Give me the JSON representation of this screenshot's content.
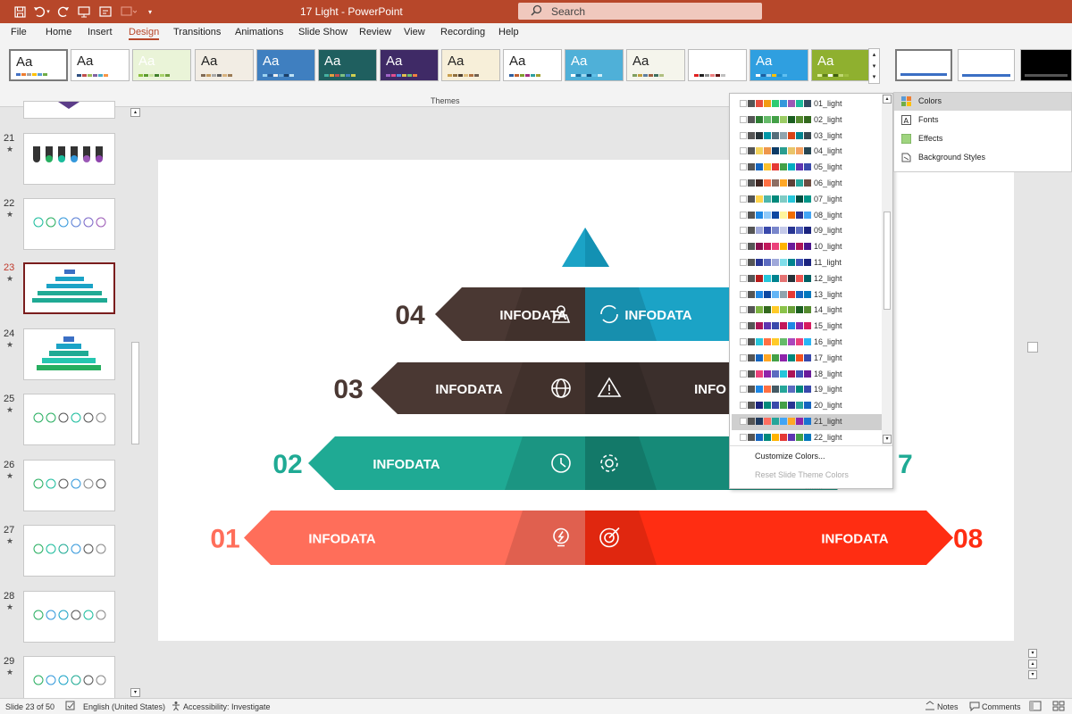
{
  "titlebar": {
    "doc_title": "17 Light  -  PowerPoint",
    "search_label": "Search"
  },
  "menu": [
    "File",
    "Home",
    "Insert",
    "Design",
    "Transitions",
    "Animations",
    "Slide Show",
    "Review",
    "View",
    "Recording",
    "Help"
  ],
  "themes": {
    "label": "Themes",
    "items": [
      {
        "bg": "#ffffff",
        "fg": "#222222",
        "pal": [
          "#4472c4",
          "#ed7d31",
          "#a5a5a5",
          "#ffc000",
          "#5b9bd5",
          "#70ad47"
        ]
      },
      {
        "bg": "#ffffff",
        "fg": "#222222",
        "pal": [
          "#2f4f7f",
          "#c0504d",
          "#9bbb59",
          "#8064a2",
          "#4bacc6",
          "#f79646"
        ]
      },
      {
        "bg": "#eaf4d8",
        "fg": "#ffffff",
        "pal": [
          "#8cbf3f",
          "#5b9b2e",
          "#c9e39c",
          "#3f7f2a",
          "#a8d26b",
          "#6e9e3c"
        ]
      },
      {
        "bg": "#f2ede4",
        "fg": "#222222",
        "pal": [
          "#7f6a55",
          "#c09860",
          "#a9a9a9",
          "#5e5e5e",
          "#d8b27f",
          "#9b7b55"
        ]
      },
      {
        "bg": "#3f7fc0",
        "fg": "#ffffff",
        "pal": [
          "#9ed3f0",
          "#2e5f99",
          "#f0f0f0",
          "#6aa7d8",
          "#1d3f66",
          "#bfe2f5"
        ]
      },
      {
        "bg": "#1f5f5f",
        "fg": "#ffffff",
        "pal": [
          "#45b0a0",
          "#e0a040",
          "#c04f4f",
          "#80c080",
          "#4080c0",
          "#d0d050"
        ]
      },
      {
        "bg": "#3f2a66",
        "fg": "#ffffff",
        "pal": [
          "#a064c8",
          "#e04f8f",
          "#4f8fe0",
          "#e0c04f",
          "#6fc06f",
          "#f08040"
        ]
      },
      {
        "bg": "#f7efd9",
        "fg": "#222222",
        "pal": [
          "#c89f4f",
          "#8f6f3f",
          "#4f3f2f",
          "#e0c080",
          "#b07040",
          "#706050"
        ]
      },
      {
        "bg": "#ffffff",
        "fg": "#222222",
        "pal": [
          "#2f5f9f",
          "#c05f2f",
          "#7f9f2f",
          "#9f2f7f",
          "#2f9f9f",
          "#9f9f2f"
        ]
      },
      {
        "bg": "#4fb0d8",
        "fg": "#ffffff",
        "pal": [
          "#ffffff",
          "#1f6f9f",
          "#9fd8f0",
          "#0f4f7f",
          "#60c0e8",
          "#d0eef8"
        ]
      },
      {
        "bg": "#f5f5ec",
        "fg": "#222222",
        "pal": [
          "#7f9f5f",
          "#c09f3f",
          "#5f7f9f",
          "#9f5f3f",
          "#3f6f5f",
          "#b0c080"
        ]
      },
      {
        "bg": "#ffffff",
        "fg": "#ffffff",
        "pal": [
          "#e02020",
          "#202020",
          "#909090",
          "#f08080",
          "#601010",
          "#c0c0c0"
        ]
      },
      {
        "bg": "#2f9fe0",
        "fg": "#ffffff",
        "pal": [
          "#ffffff",
          "#1f5f9f",
          "#9fd0f0",
          "#ffc000",
          "#1f8fcf",
          "#5fbff0"
        ]
      },
      {
        "bg": "#8fb02f",
        "fg": "#ffffff",
        "pal": [
          "#e0f0a0",
          "#5f7f1f",
          "#ffffff",
          "#3f5f10",
          "#c0d870",
          "#a0c040"
        ]
      }
    ]
  },
  "variants": [
    {
      "bg": "#ffffff"
    },
    {
      "bg": "#ffffff"
    },
    {
      "bg": "#000000"
    }
  ],
  "slides": [
    {
      "num": "21",
      "star": "★"
    },
    {
      "num": "22",
      "star": "★"
    },
    {
      "num": "23",
      "star": "★"
    },
    {
      "num": "24",
      "star": "★"
    },
    {
      "num": "25",
      "star": "★"
    },
    {
      "num": "26",
      "star": "★"
    },
    {
      "num": "27",
      "star": "★"
    },
    {
      "num": "28",
      "star": "★"
    },
    {
      "num": "29",
      "star": "★"
    }
  ],
  "colors_dropdown": {
    "items": [
      {
        "name": "01_light",
        "sw": [
          "#ffffff",
          "#555555",
          "#e84c3d",
          "#f39c12",
          "#2ecc71",
          "#3498db",
          "#9b59b6",
          "#1abc9c",
          "#34495e"
        ]
      },
      {
        "name": "02_light",
        "sw": [
          "#ffffff",
          "#555555",
          "#2e7d32",
          "#66bb6a",
          "#43a047",
          "#9ccc65",
          "#1b5e20",
          "#558b2f",
          "#33691e"
        ]
      },
      {
        "name": "03_light",
        "sw": [
          "#ffffff",
          "#555555",
          "#263238",
          "#0097a7",
          "#546e7a",
          "#90a4ae",
          "#d84315",
          "#00838f",
          "#37474f"
        ]
      },
      {
        "name": "04_light",
        "sw": [
          "#ffffff",
          "#555555",
          "#f4d35e",
          "#ee964b",
          "#0d3b66",
          "#2a9d8f",
          "#e9c46a",
          "#f4a261",
          "#264653"
        ]
      },
      {
        "name": "05_light",
        "sw": [
          "#ffffff",
          "#555555",
          "#1565c0",
          "#fbc02d",
          "#e53935",
          "#43a047",
          "#00acc1",
          "#5e35b1",
          "#3949ab"
        ]
      },
      {
        "name": "06_light",
        "sw": [
          "#ffffff",
          "#555555",
          "#3e2723",
          "#ff7043",
          "#8d6e63",
          "#ffa726",
          "#5d4037",
          "#26a69a",
          "#6d4c41"
        ]
      },
      {
        "name": "07_light",
        "sw": [
          "#ffffff",
          "#555555",
          "#ffd54f",
          "#4db6ac",
          "#00897b",
          "#80cbc4",
          "#26c6da",
          "#004d40",
          "#009688"
        ]
      },
      {
        "name": "08_light",
        "sw": [
          "#ffffff",
          "#555555",
          "#1e88e5",
          "#90caf9",
          "#0d47a1",
          "#fff59d",
          "#ef6c00",
          "#283593",
          "#42a5f5"
        ]
      },
      {
        "name": "09_light",
        "sw": [
          "#ffffff",
          "#555555",
          "#9fa8da",
          "#3949ab",
          "#7986cb",
          "#c5cae9",
          "#283593",
          "#5c6bc0",
          "#1a237e"
        ]
      },
      {
        "name": "10_light",
        "sw": [
          "#ffffff",
          "#555555",
          "#880e4f",
          "#c2185b",
          "#ec407a",
          "#ffb300",
          "#6a1b9a",
          "#ad1457",
          "#4a148c"
        ]
      },
      {
        "name": "11_light",
        "sw": [
          "#ffffff",
          "#555555",
          "#283593",
          "#5c6bc0",
          "#9fa8da",
          "#80deea",
          "#00838f",
          "#3f51b5",
          "#1a237e"
        ]
      },
      {
        "name": "12_light",
        "sw": [
          "#ffffff",
          "#555555",
          "#b71c1c",
          "#26c6da",
          "#00838f",
          "#e57373",
          "#263238",
          "#ef5350",
          "#006064"
        ]
      },
      {
        "name": "13_light",
        "sw": [
          "#ffffff",
          "#555555",
          "#1e88e5",
          "#0d47a1",
          "#64b5f6",
          "#90a4ae",
          "#e53935",
          "#1565c0",
          "#0277bd"
        ]
      },
      {
        "name": "14_light",
        "sw": [
          "#ffffff",
          "#555555",
          "#7cb342",
          "#33691e",
          "#ffca28",
          "#8bc34a",
          "#689f38",
          "#1b5e20",
          "#558b2f"
        ]
      },
      {
        "name": "15_light",
        "sw": [
          "#ffffff",
          "#555555",
          "#ad1457",
          "#5e35b1",
          "#3949ab",
          "#c2185b",
          "#1e88e5",
          "#8e24aa",
          "#d81b60"
        ]
      },
      {
        "name": "16_light",
        "sw": [
          "#ffffff",
          "#555555",
          "#26c6da",
          "#ff7043",
          "#ffca28",
          "#66bb6a",
          "#ab47bc",
          "#ec407a",
          "#29b6f6"
        ]
      },
      {
        "name": "17_light",
        "sw": [
          "#ffffff",
          "#555555",
          "#1565c0",
          "#ffa726",
          "#43a047",
          "#8e24aa",
          "#00897b",
          "#f4511e",
          "#3949ab"
        ]
      },
      {
        "name": "18_light",
        "sw": [
          "#ffffff",
          "#555555",
          "#ec407a",
          "#8e24aa",
          "#5c6bc0",
          "#26c6da",
          "#ad1457",
          "#3f51b5",
          "#6a1b9a"
        ]
      },
      {
        "name": "19_light",
        "sw": [
          "#ffffff",
          "#555555",
          "#1e88e5",
          "#ff7043",
          "#455a64",
          "#26a69a",
          "#5c6bc0",
          "#00897b",
          "#3949ab"
        ]
      },
      {
        "name": "20_light",
        "sw": [
          "#ffffff",
          "#555555",
          "#1a237e",
          "#00897b",
          "#3949ab",
          "#43a047",
          "#283593",
          "#26a69a",
          "#1565c0"
        ]
      },
      {
        "name": "21_light",
        "sw": [
          "#ffffff",
          "#555555",
          "#1e3a5f",
          "#ff6f61",
          "#26a69a",
          "#42a5f5",
          "#ffa726",
          "#8e24aa",
          "#1976d2"
        ]
      },
      {
        "name": "22_light",
        "sw": [
          "#ffffff",
          "#555555",
          "#1565c0",
          "#00897b",
          "#ffb300",
          "#e53935",
          "#5e35b1",
          "#43a047",
          "#0277bd"
        ]
      }
    ],
    "customize": "Customize Colors...",
    "reset": "Reset Slide Theme Colors",
    "dots": "........"
  },
  "variants_menu": {
    "colors": "Colors",
    "fonts": "Fonts",
    "effects": "Effects",
    "background": "Background Styles"
  },
  "slide_main": {
    "tiers": [
      {
        "left_num": "04",
        "left_text": "INFODATA",
        "right_text": "INFODATA",
        "left_color": "#4a3833",
        "right_color": "#1ba3c6",
        "left_num_color": "#4a3833"
      },
      {
        "left_num": "03",
        "left_text": "INFODATA",
        "right_text": "INFO",
        "left_color": "#4a3833",
        "right_color": "#3b2f2c",
        "left_num_color": "#4a3833"
      },
      {
        "left_num": "02",
        "left_text": "INFODATA",
        "right_text": "",
        "left_color": "#1faa94",
        "right_color": "#168a78",
        "left_num_color": "#1faa94",
        "right_num": "7"
      },
      {
        "left_num": "01",
        "left_text": "INFODATA",
        "right_text": "INFODATA",
        "left_color": "#ff6e5a",
        "right_color": "#ff2d12",
        "left_num_color": "#ff6e5a",
        "right_num": "08"
      }
    ]
  },
  "status": {
    "slide": "Slide 23 of 50",
    "lang": "English (United States)",
    "access": "Accessibility: Investigate",
    "notes": "Notes",
    "comments": "Comments"
  }
}
